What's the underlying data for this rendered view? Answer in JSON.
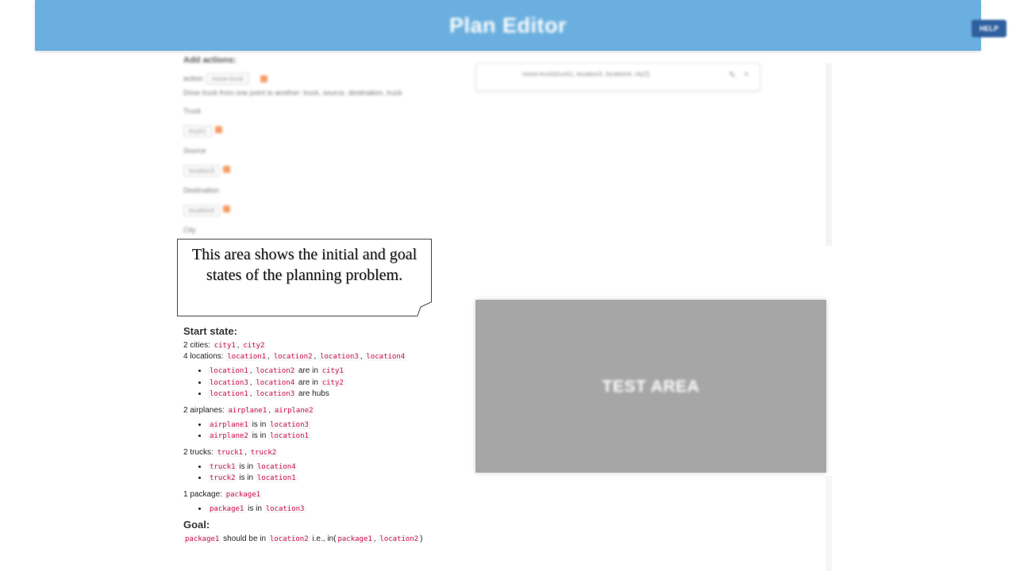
{
  "header": {
    "title": "Plan Editor",
    "help_label": "HELP"
  },
  "add_actions": {
    "title": "Add actions:",
    "action_label": "action:",
    "action_value": "move-truck",
    "description": "Drive truck from one point to another: truck, source, destination, truck",
    "fields": [
      {
        "label": "Truck",
        "value": "truck1"
      },
      {
        "label": "Source",
        "value": "location3"
      },
      {
        "label": "Destination",
        "value": "location4"
      }
    ],
    "city_label": "City"
  },
  "action_box": {
    "text": "move-truck(truck1, location3, location4, city2)"
  },
  "callout": {
    "text": "This area shows the initial and goal states of the planning problem."
  },
  "start_state": {
    "title": "Start state:",
    "cities": {
      "prefix": "2 cities:",
      "items": [
        "city1",
        "city2"
      ]
    },
    "locations": {
      "prefix": "4 locations:",
      "items": [
        "location1",
        "location2",
        "location3",
        "location4"
      ]
    },
    "location_facts": [
      {
        "a": "location1",
        "b": "location2",
        "verb": "are in",
        "c": "city1"
      },
      {
        "a": "location3",
        "b": "location4",
        "verb": "are in",
        "c": "city2"
      },
      {
        "a": "location1",
        "b": "location3",
        "verb": "are hubs"
      }
    ],
    "airplanes": {
      "prefix": "2 airplanes:",
      "items": [
        "airplane1",
        "airplane2"
      ]
    },
    "airplane_facts": [
      {
        "a": "airplane1",
        "verb": "is in",
        "c": "location3"
      },
      {
        "a": "airplane2",
        "verb": "is in",
        "c": "location1"
      }
    ],
    "trucks": {
      "prefix": "2 trucks:",
      "items": [
        "truck1",
        "truck2"
      ]
    },
    "truck_facts": [
      {
        "a": "truck1",
        "verb": "is in",
        "c": "location4"
      },
      {
        "a": "truck2",
        "verb": "is in",
        "c": "location1"
      }
    ],
    "packages": {
      "prefix": "1 package:",
      "items": [
        "package1"
      ]
    },
    "package_facts": [
      {
        "a": "package1",
        "verb": "is in",
        "c": "location3"
      }
    ]
  },
  "goal": {
    "title": "Goal:",
    "obj": "package1",
    "text": "should be in",
    "target": "location2",
    "ie": "i.e., in(",
    "arg1": "package1",
    "arg2": "location2",
    "close": ")"
  },
  "test_area": {
    "label": "TEST AREA"
  },
  "colors": {
    "header_bg": "#6aafdf",
    "code_text": "#d0104c",
    "test_area_bg": "#a6a6a6",
    "accent_orange": "#f59b63"
  }
}
